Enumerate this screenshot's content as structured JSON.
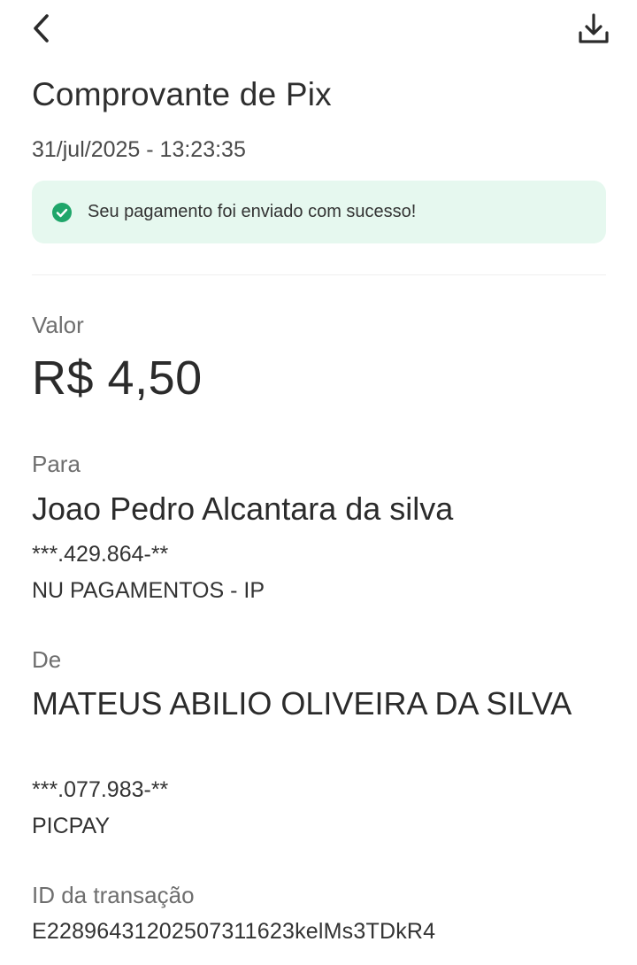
{
  "header": {
    "back_icon": "chevron-left-icon",
    "download_icon": "download-icon",
    "title": "Comprovante de Pix",
    "datetime": "31/jul/2025 - 13:23:35"
  },
  "status": {
    "icon": "check-circle-icon",
    "message": "Seu pagamento foi enviado com sucesso!",
    "color": "#e6f8ef",
    "icon_color": "#1fa66a"
  },
  "amount": {
    "label": "Valor",
    "value": "R$ 4,50"
  },
  "recipient": {
    "label": "Para",
    "name": "Joao Pedro Alcantara da silva",
    "document": "***.429.864-**",
    "institution": "NU PAGAMENTOS - IP"
  },
  "sender": {
    "label": "De",
    "name": "MATEUS ABILIO OLIVEIRA DA SILVA",
    "document": "***.077.983-**",
    "institution": "PICPAY"
  },
  "transaction": {
    "label": "ID da transação",
    "id": "E22896431202507311623kelMs3TDkR4"
  }
}
